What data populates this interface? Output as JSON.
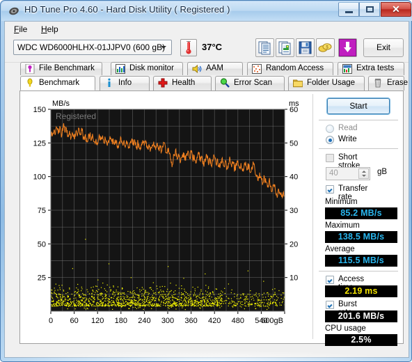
{
  "window": {
    "title": "HD Tune Pro 4.60 - Hard Disk Utility (  Registered )",
    "icon": "hdtune-logo-icon",
    "buttons": {
      "minimize": "minimize-icon",
      "maximize": "maximize-icon",
      "close": "✕"
    }
  },
  "menu": {
    "items": [
      {
        "label": "File",
        "mnemonic": "F"
      },
      {
        "label": "Help",
        "mnemonic": "H"
      }
    ]
  },
  "toolbar": {
    "drive": "WDC WD6000HLHX-01JJPV0 (600 gB)",
    "temperature": "37°C",
    "thermometer_icon": "thermometer-icon",
    "buttons": [
      {
        "name": "copy-text-icon",
        "tooltip": "Copy text"
      },
      {
        "name": "copy-image-icon",
        "tooltip": "Copy image"
      },
      {
        "name": "save-icon",
        "tooltip": "Save"
      },
      {
        "name": "money-icon",
        "tooltip": "Buy"
      },
      {
        "name": "download-icon",
        "tooltip": "Download"
      }
    ],
    "exit_label": "Exit"
  },
  "tabs": {
    "row1": [
      {
        "label": "File Benchmark",
        "icon": "file-benchmark-icon",
        "selected": false
      },
      {
        "label": "Disk monitor",
        "icon": "disk-monitor-icon",
        "selected": false
      },
      {
        "label": "AAM",
        "icon": "speaker-icon",
        "selected": false
      },
      {
        "label": "Random Access",
        "icon": "random-access-icon",
        "selected": false
      },
      {
        "label": "Extra tests",
        "icon": "extra-tests-icon",
        "selected": false
      }
    ],
    "row2": [
      {
        "label": "Benchmark",
        "icon": "benchmark-icon",
        "selected": true
      },
      {
        "label": "Info",
        "icon": "info-icon",
        "selected": false
      },
      {
        "label": "Health",
        "icon": "health-icon",
        "selected": false
      },
      {
        "label": "Error Scan",
        "icon": "magnifier-icon",
        "selected": false
      },
      {
        "label": "Folder Usage",
        "icon": "folder-icon",
        "selected": false
      },
      {
        "label": "Erase",
        "icon": "trash-icon",
        "selected": false
      }
    ]
  },
  "controls": {
    "start_label": "Start",
    "mode": {
      "read_label": "Read",
      "write_label": "Write",
      "selected": "Write"
    },
    "short_stroke": {
      "label": "Short stroke",
      "checked": false,
      "value": "40",
      "unit": "gB"
    },
    "transfer_rate": {
      "label": "Transfer rate",
      "checked": true,
      "minimum_label": "Minimum",
      "minimum_value": "85.2 MB/s",
      "maximum_label": "Maximum",
      "maximum_value": "138.5 MB/s",
      "average_label": "Average",
      "average_value": "115.5 MB/s"
    },
    "access_time": {
      "label": "Access time",
      "checked": true,
      "value": "2.19 ms"
    },
    "burst_rate": {
      "label": "Burst rate",
      "checked": true,
      "value": "201.6 MB/s"
    },
    "cpu_usage": {
      "label": "CPU usage",
      "value": "2.5%"
    }
  },
  "chart_data": {
    "type": "line",
    "title": "",
    "watermark": "Registered",
    "ylabel": "MB/s",
    "y2label": "ms",
    "xlabel": "gB",
    "xlim": [
      0,
      600
    ],
    "ylim": [
      0,
      150
    ],
    "y2lim": [
      0,
      60
    ],
    "grid": true,
    "xticks": [
      0,
      60,
      120,
      180,
      240,
      300,
      360,
      420,
      480,
      540,
      600
    ],
    "xticklabels": [
      "0",
      "60",
      "120",
      "180",
      "240",
      "300",
      "360",
      "420",
      "480",
      "540",
      "600gB"
    ],
    "yticks": [
      25,
      50,
      75,
      100,
      125,
      150
    ],
    "yticklabels": [
      "25",
      "50",
      "75",
      "100",
      "125",
      "150"
    ],
    "y2ticks": [
      10,
      20,
      30,
      40,
      50,
      60
    ],
    "y2ticklabels": [
      "10",
      "20",
      "30",
      "40",
      "50",
      "60"
    ],
    "colors": {
      "transfer_rate": "#f08020",
      "access_time": "#ffff00",
      "plot_background": "#141414",
      "grid": "#8c8c8c"
    },
    "series": [
      {
        "name": "Transfer rate",
        "unit": "MB/s",
        "axis": "left",
        "color": "#f08020",
        "x": [
          0,
          4,
          8,
          12,
          16,
          20,
          24,
          28,
          32,
          36,
          40,
          44,
          48,
          52,
          56,
          60,
          64,
          68,
          72,
          76,
          80,
          84,
          88,
          92,
          96,
          100,
          104,
          108,
          112,
          116,
          120,
          124,
          128,
          132,
          136,
          140,
          144,
          148,
          152,
          156,
          160,
          164,
          168,
          172,
          176,
          180,
          184,
          188,
          192,
          196,
          200,
          204,
          208,
          212,
          216,
          220,
          224,
          228,
          232,
          236,
          240,
          244,
          248,
          252,
          256,
          260,
          264,
          268,
          272,
          276,
          280,
          284,
          288,
          292,
          296,
          300,
          304,
          308,
          312,
          316,
          320,
          324,
          328,
          332,
          336,
          340,
          344,
          348,
          352,
          356,
          360,
          364,
          368,
          372,
          376,
          380,
          384,
          388,
          392,
          396,
          400,
          404,
          408,
          412,
          416,
          420,
          424,
          428,
          432,
          436,
          440,
          444,
          448,
          452,
          456,
          460,
          464,
          468,
          472,
          476,
          480,
          484,
          488,
          492,
          496,
          500,
          504,
          508,
          512,
          516,
          520,
          524,
          528,
          532,
          536,
          540,
          544,
          548,
          552,
          556,
          560,
          564,
          568,
          572,
          576,
          580,
          584,
          588,
          592,
          596,
          600
        ],
        "y": [
          133,
          130,
          134,
          132,
          136,
          133,
          137,
          130,
          138,
          133,
          136,
          131,
          134,
          129,
          132,
          128,
          133,
          130,
          136,
          131,
          134,
          129,
          131,
          126,
          129,
          131,
          127,
          130,
          126,
          128,
          124,
          131,
          127,
          129,
          125,
          128,
          124,
          127,
          130,
          126,
          128,
          124,
          127,
          123,
          126,
          129,
          125,
          127,
          123,
          126,
          122,
          125,
          128,
          124,
          126,
          122,
          125,
          121,
          124,
          127,
          123,
          125,
          121,
          124,
          120,
          123,
          126,
          122,
          124,
          120,
          123,
          119,
          122,
          125,
          118,
          121,
          117,
          113,
          109,
          116,
          120,
          113,
          117,
          110,
          114,
          118,
          112,
          116,
          119,
          114,
          118,
          113,
          116,
          110,
          114,
          117,
          111,
          115,
          109,
          113,
          116,
          110,
          114,
          108,
          112,
          115,
          109,
          113,
          107,
          111,
          114,
          108,
          112,
          106,
          110,
          113,
          107,
          111,
          105,
          109,
          112,
          106,
          110,
          104,
          108,
          111,
          105,
          109,
          103,
          107,
          110,
          104,
          101,
          97,
          103,
          99,
          95,
          100,
          96,
          92,
          97,
          93,
          89,
          94,
          90,
          86,
          91,
          88,
          85,
          88,
          86
        ]
      },
      {
        "name": "Access time",
        "unit": "ms",
        "axis": "right",
        "color": "#ffff00",
        "note": "scatter cloud, majority 2-5 ms with outliers up to ~22 ms"
      }
    ],
    "access_time_points": [
      [
        2,
        4.2
      ],
      [
        5,
        3.1
      ],
      [
        8,
        5.8
      ],
      [
        11,
        2.2
      ],
      [
        14,
        4.6
      ],
      [
        17,
        6.4
      ],
      [
        20,
        3.3
      ],
      [
        23,
        5.1
      ],
      [
        26,
        2.7
      ],
      [
        29,
        4.9
      ],
      [
        32,
        6.1
      ],
      [
        35,
        3.6
      ],
      [
        38,
        5.4
      ],
      [
        41,
        2.4
      ],
      [
        44,
        4.4
      ],
      [
        47,
        6.7
      ],
      [
        50,
        3.0
      ],
      [
        53,
        5.2
      ],
      [
        56,
        2.9
      ],
      [
        59,
        4.7
      ],
      [
        62,
        6.0
      ],
      [
        65,
        3.4
      ],
      [
        68,
        5.6
      ],
      [
        71,
        2.6
      ],
      [
        74,
        4.3
      ],
      [
        77,
        6.2
      ],
      [
        80,
        3.2
      ],
      [
        83,
        5.0
      ],
      [
        86,
        2.8
      ],
      [
        89,
        4.8
      ],
      [
        92,
        6.5
      ],
      [
        95,
        3.7
      ],
      [
        98,
        5.3
      ],
      [
        101,
        2.3
      ],
      [
        104,
        4.5
      ],
      [
        107,
        6.3
      ],
      [
        110,
        3.1
      ],
      [
        113,
        5.7
      ],
      [
        116,
        2.5
      ],
      [
        119,
        4.1
      ],
      [
        122,
        6.6
      ],
      [
        125,
        3.5
      ],
      [
        128,
        5.5
      ],
      [
        131,
        2.1
      ],
      [
        134,
        4.0
      ],
      [
        137,
        6.8
      ],
      [
        140,
        3.8
      ],
      [
        143,
        5.9
      ],
      [
        146,
        2.2
      ],
      [
        149,
        4.6
      ],
      [
        152,
        6.1
      ],
      [
        155,
        3.3
      ],
      [
        158,
        5.1
      ],
      [
        161,
        2.7
      ],
      [
        164,
        4.9
      ],
      [
        167,
        6.4
      ],
      [
        170,
        3.6
      ],
      [
        173,
        5.4
      ],
      [
        176,
        2.4
      ],
      [
        179,
        4.4
      ],
      [
        182,
        6.7
      ],
      [
        185,
        3.0
      ],
      [
        188,
        5.2
      ],
      [
        191,
        2.9
      ],
      [
        194,
        4.7
      ],
      [
        197,
        6.0
      ],
      [
        200,
        3.4
      ],
      [
        203,
        5.6
      ],
      [
        206,
        2.6
      ],
      [
        209,
        4.3
      ],
      [
        212,
        6.2
      ],
      [
        215,
        3.2
      ],
      [
        218,
        5.0
      ],
      [
        221,
        2.8
      ],
      [
        224,
        4.8
      ],
      [
        227,
        6.5
      ],
      [
        230,
        3.7
      ],
      [
        233,
        5.3
      ],
      [
        236,
        2.3
      ],
      [
        239,
        4.5
      ],
      [
        242,
        6.3
      ],
      [
        245,
        3.1
      ],
      [
        248,
        5.7
      ],
      [
        251,
        2.5
      ],
      [
        254,
        4.1
      ],
      [
        257,
        6.6
      ],
      [
        260,
        3.5
      ],
      [
        263,
        5.5
      ],
      [
        266,
        2.1
      ],
      [
        269,
        4.0
      ],
      [
        272,
        6.8
      ],
      [
        275,
        3.8
      ],
      [
        278,
        5.9
      ],
      [
        281,
        2.2
      ],
      [
        284,
        4.6
      ],
      [
        287,
        6.1
      ],
      [
        290,
        3.3
      ],
      [
        293,
        5.1
      ],
      [
        296,
        2.7
      ],
      [
        299,
        4.9
      ],
      [
        302,
        5.4
      ],
      [
        306,
        3.2
      ],
      [
        310,
        4.8
      ],
      [
        314,
        2.6
      ],
      [
        318,
        5.2
      ],
      [
        322,
        3.9
      ],
      [
        326,
        4.4
      ],
      [
        330,
        2.4
      ],
      [
        334,
        5.6
      ],
      [
        338,
        3.1
      ],
      [
        342,
        4.7
      ],
      [
        346,
        2.9
      ],
      [
        350,
        5.3
      ],
      [
        354,
        3.6
      ],
      [
        358,
        4.2
      ],
      [
        362,
        2.5
      ],
      [
        366,
        5.0
      ],
      [
        370,
        3.4
      ],
      [
        374,
        4.6
      ],
      [
        378,
        2.8
      ],
      [
        382,
        5.5
      ],
      [
        386,
        3.0
      ],
      [
        390,
        4.3
      ],
      [
        394,
        2.6
      ],
      [
        398,
        5.1
      ],
      [
        402,
        3.7
      ],
      [
        406,
        4.5
      ],
      [
        410,
        2.3
      ],
      [
        414,
        5.8
      ],
      [
        418,
        3.2
      ],
      [
        422,
        4.1
      ],
      [
        426,
        2.7
      ],
      [
        430,
        5.2
      ],
      [
        434,
        3.5
      ],
      [
        438,
        4.8
      ],
      [
        442,
        2.4
      ],
      [
        446,
        5.4
      ],
      [
        450,
        3.3
      ],
      [
        454,
        4.0
      ],
      [
        458,
        2.8
      ],
      [
        462,
        5.6
      ],
      [
        466,
        3.1
      ],
      [
        470,
        4.4
      ],
      [
        474,
        2.5
      ],
      [
        478,
        5.0
      ],
      [
        482,
        3.8
      ],
      [
        486,
        4.2
      ],
      [
        490,
        2.9
      ],
      [
        494,
        5.3
      ],
      [
        498,
        3.4
      ],
      [
        502,
        4.6
      ],
      [
        506,
        2.6
      ],
      [
        510,
        5.1
      ],
      [
        514,
        3.6
      ],
      [
        518,
        4.0
      ],
      [
        522,
        2.3
      ],
      [
        526,
        5.5
      ],
      [
        530,
        3.2
      ],
      [
        534,
        4.7
      ],
      [
        538,
        2.8
      ],
      [
        542,
        5.0
      ],
      [
        546,
        3.5
      ],
      [
        550,
        4.3
      ],
      [
        554,
        2.4
      ],
      [
        558,
        5.2
      ],
      [
        562,
        3.9
      ],
      [
        566,
        4.5
      ],
      [
        570,
        2.7
      ],
      [
        574,
        5.7
      ],
      [
        578,
        3.3
      ],
      [
        582,
        4.1
      ],
      [
        586,
        2.6
      ],
      [
        590,
        4.9
      ],
      [
        594,
        3.0
      ],
      [
        598,
        4.4
      ],
      [
        55,
        12.8
      ],
      [
        88,
        21.5
      ],
      [
        120,
        9.4
      ],
      [
        148,
        14.2
      ],
      [
        205,
        10.1
      ],
      [
        262,
        8.6
      ],
      [
        300,
        13.4
      ],
      [
        340,
        9.9
      ],
      [
        395,
        11.2
      ],
      [
        455,
        8.2
      ],
      [
        505,
        12.1
      ],
      [
        545,
        9.0
      ]
    ]
  }
}
